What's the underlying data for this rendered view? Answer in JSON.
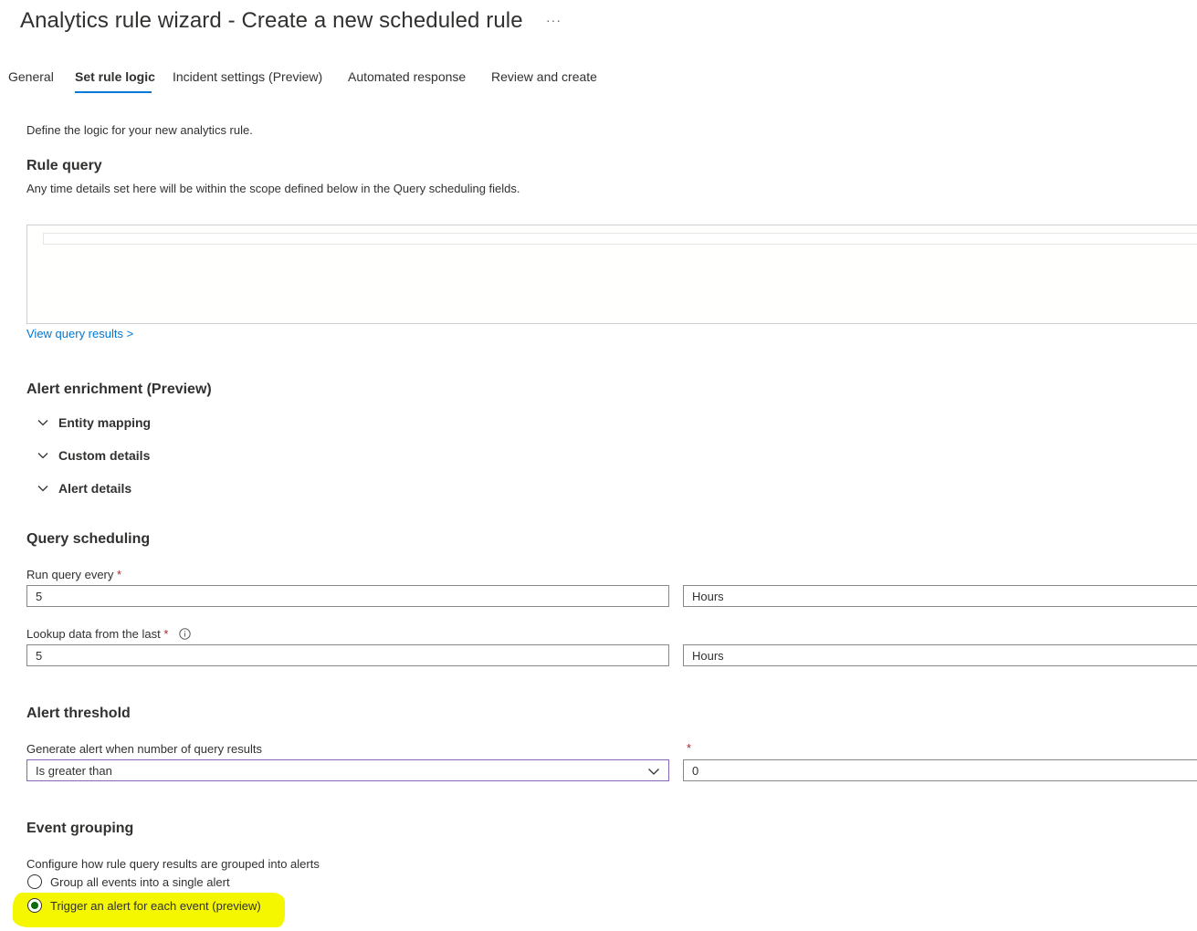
{
  "header": {
    "title": "Analytics rule wizard - Create a new scheduled rule",
    "more_label": "···"
  },
  "tabs": [
    {
      "label": "General",
      "active": false
    },
    {
      "label": "Set rule logic",
      "active": true
    },
    {
      "label": "Incident settings (Preview)",
      "active": false
    },
    {
      "label": "Automated response",
      "active": false
    },
    {
      "label": "Review and create",
      "active": false
    }
  ],
  "intro": "Define the logic for your new analytics rule.",
  "rule_query": {
    "heading": "Rule query",
    "description": "Any time details set here will be within the scope defined below in the Query scheduling fields.",
    "editor_value": "",
    "view_results_link": "View query results >"
  },
  "alert_enrichment": {
    "heading": "Alert enrichment (Preview)",
    "sections": [
      {
        "label": "Entity mapping",
        "icon": "chevron-down-icon"
      },
      {
        "label": "Custom details",
        "icon": "chevron-down-icon"
      },
      {
        "label": "Alert details",
        "icon": "chevron-down-icon"
      }
    ]
  },
  "query_scheduling": {
    "heading": "Query scheduling",
    "run_every": {
      "label": "Run query every",
      "required_mark": "*",
      "value": "5",
      "unit": "Hours"
    },
    "lookup": {
      "label": "Lookup data from the last",
      "required_mark": "*",
      "value": "5",
      "unit": "Hours",
      "icon": "info-icon"
    }
  },
  "alert_threshold": {
    "heading": "Alert threshold",
    "label": "Generate alert when number of query results",
    "operator": "Is greater than",
    "value_required_mark": "*",
    "value": "0"
  },
  "event_grouping": {
    "heading": "Event grouping",
    "description": "Configure how rule query results are grouped into alerts",
    "options": [
      {
        "label": "Group all events into a single alert",
        "selected": false
      },
      {
        "label": "Trigger an alert for each event (preview)",
        "selected": true
      }
    ],
    "highlight_color": "#f4f700"
  },
  "colors": {
    "accent": "#0078d4",
    "required": "#a4262c",
    "radio_selected": "#0b6a0b"
  }
}
